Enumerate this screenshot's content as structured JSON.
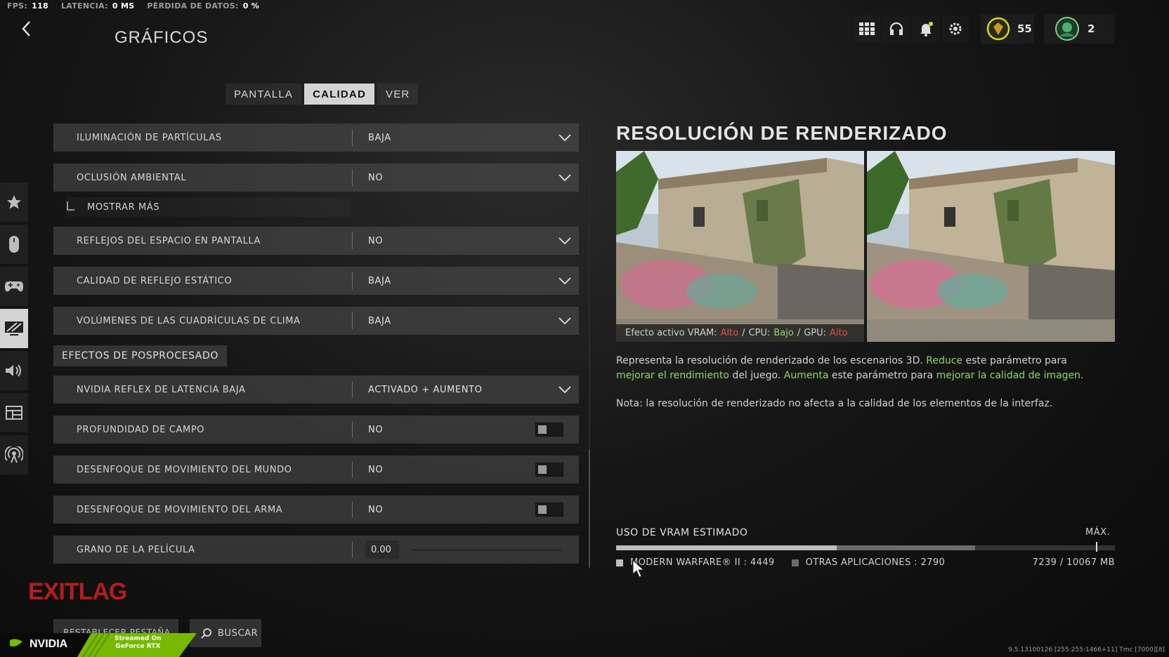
{
  "stats": {
    "fps_label": "FPS:",
    "fps_value": "118",
    "latency_label": "LATENCIA:",
    "latency_value": "0 MS",
    "loss_label": "PÉRDIDA DE DATOS:",
    "loss_value": "0 %"
  },
  "header": {
    "title": "GRÁFICOS",
    "rank_level": "55",
    "player_count": "2"
  },
  "tabs": [
    {
      "label": "PANTALLA",
      "active": false
    },
    {
      "label": "CALIDAD",
      "active": true
    },
    {
      "label": "VER",
      "active": false
    }
  ],
  "settings": {
    "particle_lighting": {
      "label": "ILUMINACIÓN DE PARTÍCULAS",
      "value": "BAJA"
    },
    "ambient_occlusion": {
      "label": "OCLUSIÓN AMBIENTAL",
      "value": "NO"
    },
    "show_more": "MOSTRAR MÁS",
    "ssr": {
      "label": "REFLEJOS DEL ESPACIO EN PANTALLA",
      "value": "NO"
    },
    "static_reflection": {
      "label": "CALIDAD DE REFLEJO ESTÁTICO",
      "value": "BAJA"
    },
    "weather_grid": {
      "label": "VOLÚMENES DE LAS CUADRÍCULAS DE CLIMA",
      "value": "BAJA"
    },
    "section_post": "EFECTOS DE POSPROCESADO",
    "reflex": {
      "label": "NVIDIA REFLEX DE LATENCIA BAJA",
      "value": "ACTIVADO + AUMENTO"
    },
    "dof": {
      "label": "PROFUNDIDAD DE CAMPO",
      "value": "NO"
    },
    "world_blur": {
      "label": "DESENFOQUE DE MOVIMIENTO DEL MUNDO",
      "value": "NO"
    },
    "weapon_blur": {
      "label": "DESENFOQUE DE MOVIMIENTO DEL ARMA",
      "value": "NO"
    },
    "film_grain": {
      "label": "GRANO DE LA PELÍCULA",
      "value": "0.00",
      "level": 0
    }
  },
  "detail": {
    "title": "RESOLUCIÓN DE RENDERIZADO",
    "effect_prefix": "Efecto activo VRAM:",
    "vram_effect": "Alto",
    "cpu_label": "CPU:",
    "cpu_effect": "Bajo",
    "gpu_label": "GPU:",
    "gpu_effect": "Alto",
    "separator": "/",
    "desc_1": "Representa la resolución de renderizado de los escenarios 3D. ",
    "desc_reduce": "Reduce",
    "desc_2": " este parámetro para ",
    "desc_improve_perf": "mejorar el rendimiento",
    "desc_3": " del juego. ",
    "desc_increase": "Aumenta",
    "desc_4": " este parámetro para ",
    "desc_improve_quality": "mejorar la calidad de imagen.",
    "note": "Nota: la resolución de renderizado no afecta a la calidad de los elementos de la interfaz."
  },
  "vram": {
    "title": "USO DE VRAM ESTIMADO",
    "max_label": "MÁX.",
    "mw_label": "MODERN WARFARE® II : 4449",
    "other_label": "OTRAS APLICACIONES : 2790",
    "total_label": "7239 / 10067 MB",
    "mw_mb": 4449,
    "other_mb": 2790,
    "total_mb": 10067,
    "colors": {
      "mw": "#bdbdbd",
      "other": "#6b6b6b"
    }
  },
  "footer": {
    "reset_label": "RESTABLECER PESTAÑA",
    "search_label": "BUSCAR",
    "exitlag": "EXITLAG",
    "nvidia": "NVIDIA",
    "geforce_line1": "Streamed On",
    "geforce_line2": "GeForce RTX",
    "version": "9.5.13100126 [255:255:1466+11] Tmc [7000][8]"
  },
  "accent_colors": {
    "green": "#8fd36f",
    "red": "#e2533f"
  }
}
